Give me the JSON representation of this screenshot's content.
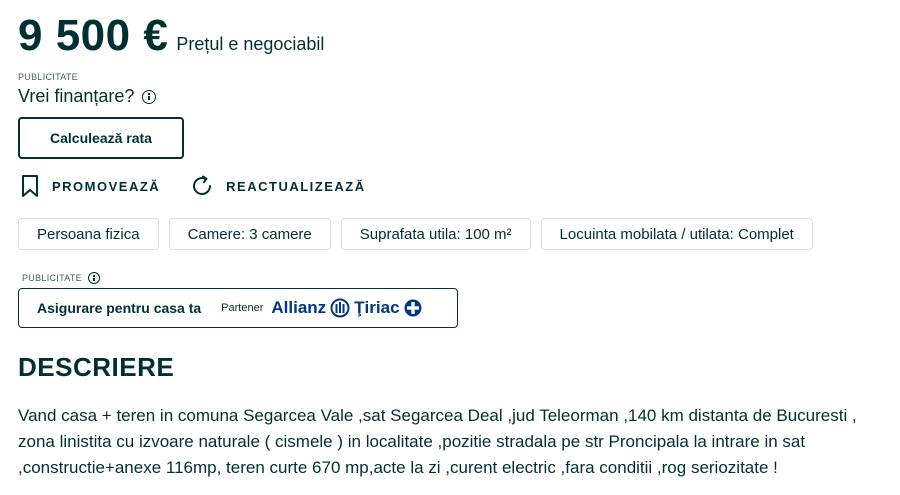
{
  "price": {
    "amount": "9 500 €",
    "negotiable": "Prețul e negociabil"
  },
  "ad": {
    "label": "PUBLICITATE",
    "finance_question": "Vrei finanțare?",
    "calculate_button": "Calculează rata"
  },
  "actions": {
    "promote": "PROMOVEAZĂ",
    "refresh": "REACTUALIZEAZĂ"
  },
  "tags": [
    "Persoana fizica",
    "Camere: 3 camere",
    "Suprafata utila: 100 m²",
    "Locuinta mobilata / utilata: Complet"
  ],
  "insurance": {
    "label": "PUBLICITATE",
    "title": "Asigurare pentru casa ta",
    "partner": "Partener",
    "brand": "Allianz",
    "brand2": "Ţiriac"
  },
  "description": {
    "title": "DESCRIERE",
    "text": "Vand casa + teren in comuna Segarcea Vale ,sat Segarcea Deal ,jud Teleorman ,140 km distanta de Bucuresti , zona linistita cu izvoare naturale ( cismele ) in localitate ,pozitie stradala pe str Proncipala la intrare in sat ,constructie+anexe 116mp, teren curte 670 mp,acte la zi ,curent electric ,fara conditii ,rog seriozitate !"
  },
  "colors": {
    "text": "#002f34",
    "allianz_blue": "#003781",
    "tag_border": "#d8dfe0"
  }
}
